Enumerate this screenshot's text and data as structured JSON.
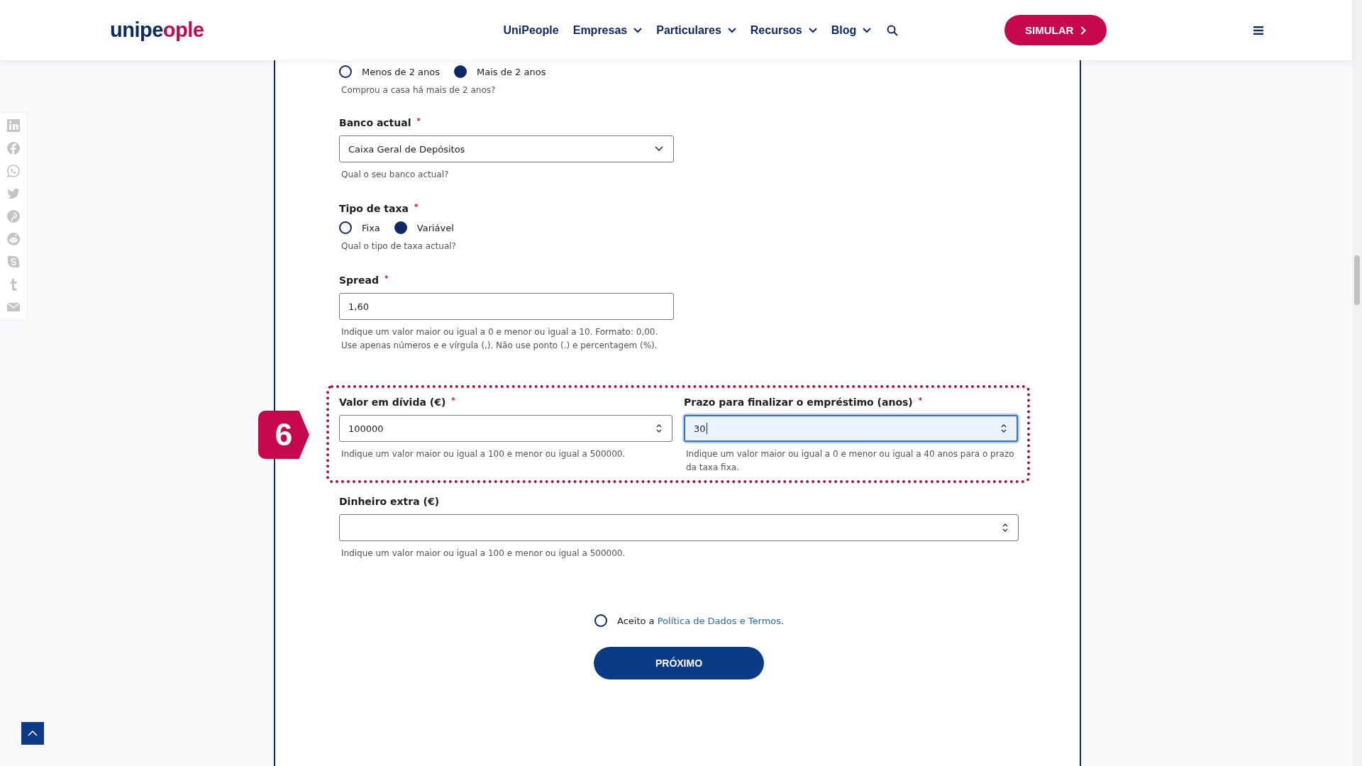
{
  "header": {
    "logo": "unipeople",
    "nav": [
      {
        "label": "UniPeople",
        "dropdown": false
      },
      {
        "label": "Empresas",
        "dropdown": true
      },
      {
        "label": "Particulares",
        "dropdown": true
      },
      {
        "label": "Recursos",
        "dropdown": true
      },
      {
        "label": "Blog",
        "dropdown": true
      }
    ],
    "cta": "SIMULAR"
  },
  "social": [
    {
      "kind": "linkedin"
    },
    {
      "kind": "facebook"
    },
    {
      "kind": "whatsapp"
    },
    {
      "kind": "twitter"
    },
    {
      "kind": "pinterest"
    },
    {
      "kind": "reddit"
    },
    {
      "kind": "skype"
    },
    {
      "kind": "tumblr"
    },
    {
      "kind": "email"
    }
  ],
  "form": {
    "fields": [
      {
        "kind": "radio",
        "options": [
          {
            "label": "Menos de 2 anos",
            "selected": false
          },
          {
            "label": "Mais de 2 anos",
            "selected": true
          }
        ],
        "helper": "Comprou a casa há mais de 2 anos?"
      },
      {
        "kind": "select",
        "label": "Banco actual",
        "required_mark": "*",
        "value": "Caixa Geral de Depósitos",
        "helper": "Qual o seu banco actual?"
      },
      {
        "kind": "radio",
        "label": "Tipo de taxa",
        "required_mark": "*",
        "options": [
          {
            "label": "Fixa",
            "selected": false
          },
          {
            "label": "Variável",
            "selected": true
          }
        ],
        "helper": "Qual o tipo de taxa actual?"
      },
      {
        "kind": "text",
        "label": "Spread",
        "required_mark": "*",
        "value": "1,60",
        "helper": "Indique um valor maior ou igual a 0 e menor ou igual a 10. Formato: 0,00. Use apenas números e e vírgula (,). Não use ponto (.) e percentagem (%)."
      },
      {
        "kind": "group",
        "badge": "6",
        "fields": [
          {
            "kind": "number",
            "label": "Valor em dívida (€)",
            "required_mark": "*",
            "value": "100000",
            "focused": false,
            "helper": "Indique um valor maior ou igual a 100 e menor ou igual a 500000."
          },
          {
            "kind": "number",
            "label": "Prazo para finalizar o empréstimo (anos)",
            "required_mark": "*",
            "value": "30",
            "focused": true,
            "helper": "Indique um valor maior ou igual a 0 e menor ou igual a 40 anos para o prazo da taxa fixa."
          }
        ]
      },
      {
        "kind": "number",
        "label": "Dinheiro extra (€)",
        "focused": false,
        "helper": "Indique um valor maior ou igual a 100 e menor ou igual a 500000."
      }
    ],
    "consent": {
      "checked": false,
      "text": "Aceito a ",
      "link": "Política de Dados e Termos",
      "after": "."
    },
    "submit": "PRÓXIMO"
  }
}
